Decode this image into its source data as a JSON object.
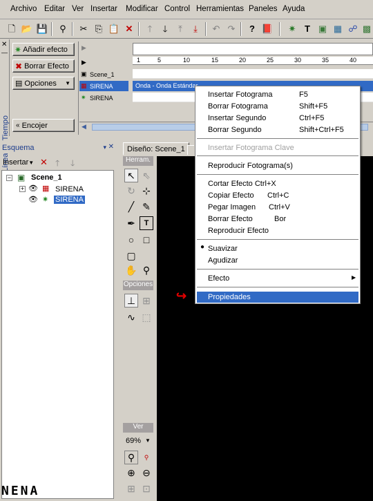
{
  "menubar": {
    "items": [
      "Archivo",
      "Editar",
      "Ver",
      "Insertar",
      "Modificar",
      "Control",
      "Herramientas",
      "Paneles",
      "Ayuda"
    ]
  },
  "timeline": {
    "vertical_label": "Línea de Tiempo",
    "add_effect": "Añadir efecto",
    "delete_effect": "Borrar Efecto",
    "options": "Opciones",
    "shrink": "Encojer",
    "layers": [
      "Scene_1",
      "SIRENA",
      "SIRENA"
    ],
    "ruler_ticks": [
      "1",
      "5",
      "10",
      "15",
      "20",
      "25",
      "30",
      "35",
      "40"
    ],
    "effect_bar": "Onda - Onda Estándar"
  },
  "outline": {
    "title": "Esquema",
    "insert_label": "Insertar",
    "tree": {
      "scene": "Scene_1",
      "items": [
        "SIRENA",
        "SIRENA"
      ]
    }
  },
  "design": {
    "tab": "Diseño: Scene_1"
  },
  "tools": {
    "header": "Herram.",
    "options_header": "Opciones",
    "view_header": "Ver",
    "zoom": "69%"
  },
  "logo": "NENA",
  "context_menu": {
    "items": [
      {
        "label": "Insertar Fotograma",
        "shortcut": "F5",
        "disabled": false
      },
      {
        "label": "Borrar Fotograma",
        "shortcut": "Shift+F5",
        "disabled": false
      },
      {
        "label": "Insertar Segundo",
        "shortcut": "Ctrl+F5",
        "disabled": false
      },
      {
        "label": "Borrar Segundo",
        "shortcut": "Shift+Ctrl+F5",
        "disabled": false
      },
      {
        "label": "Insertar Fotograma Clave",
        "shortcut": "",
        "disabled": true
      },
      {
        "label": "Reproducir Fotograma(s)",
        "shortcut": "",
        "disabled": false
      },
      {
        "label": "Cortar Efecto Ctrl+X",
        "shortcut": "",
        "disabled": false
      },
      {
        "label": "Copiar Efecto",
        "shortcut": "Ctrl+C",
        "disabled": false
      },
      {
        "label": "Pegar Imagen",
        "shortcut": "Ctrl+V",
        "disabled": false
      },
      {
        "label": "Borrar Efecto",
        "shortcut": "Bor",
        "disabled": false
      },
      {
        "label": "Reproducir Efecto",
        "shortcut": "",
        "disabled": false
      },
      {
        "label": "Suavizar",
        "shortcut": "",
        "disabled": false,
        "checked": true
      },
      {
        "label": "Agudizar",
        "shortcut": "",
        "disabled": false
      },
      {
        "label": "Efecto",
        "shortcut": "",
        "disabled": false,
        "submenu": true
      },
      {
        "label": "Propiedades",
        "shortcut": "",
        "disabled": false,
        "highlighted": true
      }
    ]
  },
  "colors": {
    "highlight": "#316ac5",
    "canvas": "#000000",
    "panel": "#d4d0c8",
    "title": "#1c3c8c"
  }
}
